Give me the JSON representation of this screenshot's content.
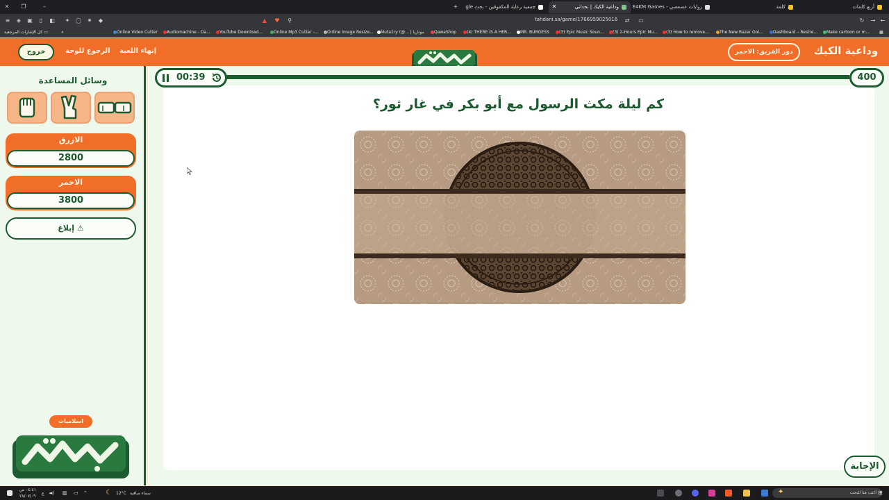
{
  "browser": {
    "tabs": [
      {
        "label": "أربع كلمات",
        "fav": "#f5c518"
      },
      {
        "label": "كلمة",
        "fav": "#f5c518"
      },
      {
        "label": "روايات عصعصي - E4KM Games",
        "fav": "#e0e0e0"
      },
      {
        "label": "وداعية الكيك | تحداني",
        "fav": "#7fc48a",
        "active": true
      },
      {
        "label": "جمعية رعاية المكفوفين - بحث Google",
        "fav": "#ffffff"
      }
    ],
    "url": "tahdani.sa/game/1766959025016",
    "bookmarks_folder": "كل الإشارات المرجعية",
    "bookmarks": [
      {
        "label": "Online Video Cutter",
        "color": "#3a8dde"
      },
      {
        "label": "Audiomachine - Da...",
        "color": "#ff2d2d"
      },
      {
        "label": "YouTube Download...",
        "color": "#ff2d2d"
      },
      {
        "label": "Online Mp3 Cutter -...",
        "color": "#3ab26b"
      },
      {
        "label": "Online Image Resize...",
        "color": "#bbbbbb"
      },
      {
        "label": "Muta1ry (@... | موتاريا",
        "color": "#ffffff"
      },
      {
        "label": "QawaShop",
        "color": "#ff3b5c"
      },
      {
        "label": "(4) THERE IS A HER...",
        "color": "#ff2d2d"
      },
      {
        "label": "MR. BURGESS",
        "color": "#ffffff"
      },
      {
        "label": "(3) Epic Music Soun...",
        "color": "#ff2d2d"
      },
      {
        "label": "(3) 2-Hours Epic Mu...",
        "color": "#ff2d2d"
      },
      {
        "label": "(3) How to remove...",
        "color": "#ff2d2d"
      },
      {
        "label": "The New Razer Gol...",
        "color": "#f5a623"
      },
      {
        "label": "Dashboard – Restre...",
        "color": "#3a6bde"
      },
      {
        "label": "Make cartoon or m...",
        "color": "#2ecc71"
      }
    ]
  },
  "header": {
    "exit": "خروج",
    "back_to_board": "الرجوع للوحة",
    "end_game": "إنهاء اللعبة",
    "turn": "دور الفريق: الاحمر",
    "game_name": "وداعية الكيك"
  },
  "aids": {
    "title": "وسائل المساعدة",
    "items": [
      "double-answer-icon",
      "two-answers-icon",
      "raise-hand-icon"
    ]
  },
  "teams": [
    {
      "name": "الازرق",
      "score": "2800"
    },
    {
      "name": "الاحمر",
      "score": "3800"
    }
  ],
  "report": "إبلاغ",
  "category": "اسلاميات",
  "timer": "00:39",
  "points": "400",
  "question": "كم ليلة مكث الرسول مع أبو بكر في غار ثور؟",
  "answer_button": "الإجابة",
  "taskbar": {
    "weather_temp": "12°C",
    "weather_desc": "سماء صافية",
    "time": "٠٤:٤١ ص",
    "date": "٢٨/٠٧/٠٩",
    "lang": "ع",
    "search_placeholder": "اكتب هنا للبحث"
  },
  "colors": {
    "brand_orange": "#f16e29",
    "brand_green": "#1c5a30",
    "panel_bg": "#eff8ec"
  }
}
